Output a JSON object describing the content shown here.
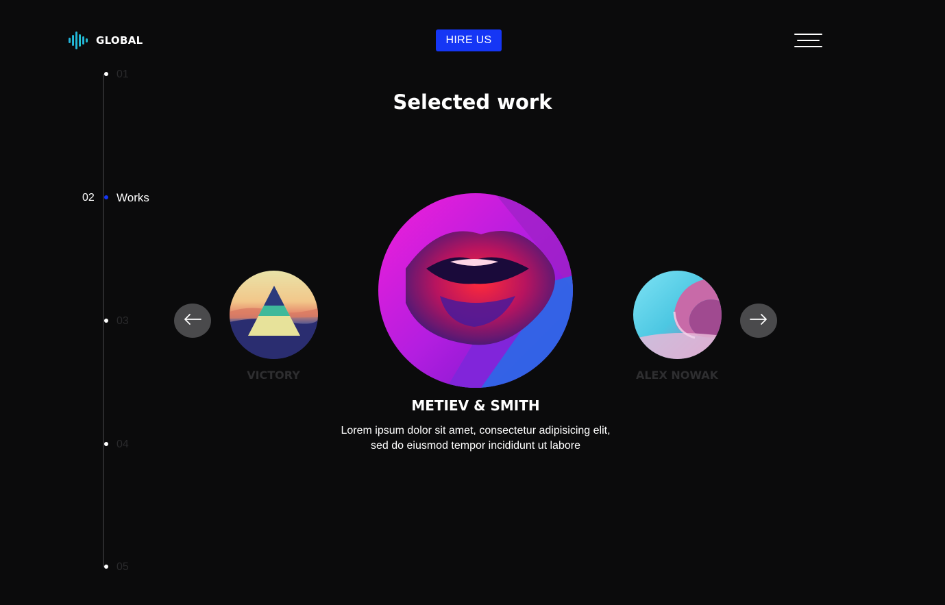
{
  "header": {
    "logo_text": "GLOBAL",
    "logo_icon": "sound-wave-icon",
    "hire_label": "HIRE US",
    "menu_icon": "hamburger-menu-icon"
  },
  "timeline": {
    "items": [
      {
        "num": "01",
        "label": ""
      },
      {
        "num": "02",
        "label": "Works"
      },
      {
        "num": "03",
        "label": ""
      },
      {
        "num": "04",
        "label": ""
      },
      {
        "num": "05",
        "label": ""
      }
    ],
    "active_index": 1
  },
  "section": {
    "title": "Selected work"
  },
  "carousel": {
    "prev_icon": "arrow-left-icon",
    "next_icon": "arrow-right-icon",
    "left": {
      "name": "VICTORY",
      "image": "triangle-sunset-image"
    },
    "center": {
      "name": "METIEV & SMITH",
      "image": "neon-lips-image",
      "description": "Lorem ipsum dolor sit amet, consectetur adipisicing elit, sed do eiusmod tempor incididunt ut labore"
    },
    "right": {
      "name": "ALEX NOWAK",
      "image": "pink-wave-image"
    }
  },
  "colors": {
    "background": "#0b0b0c",
    "accent": "#1536f5",
    "muted_text": "#2e2e30",
    "arrow_bg": "#4a4a4c"
  }
}
